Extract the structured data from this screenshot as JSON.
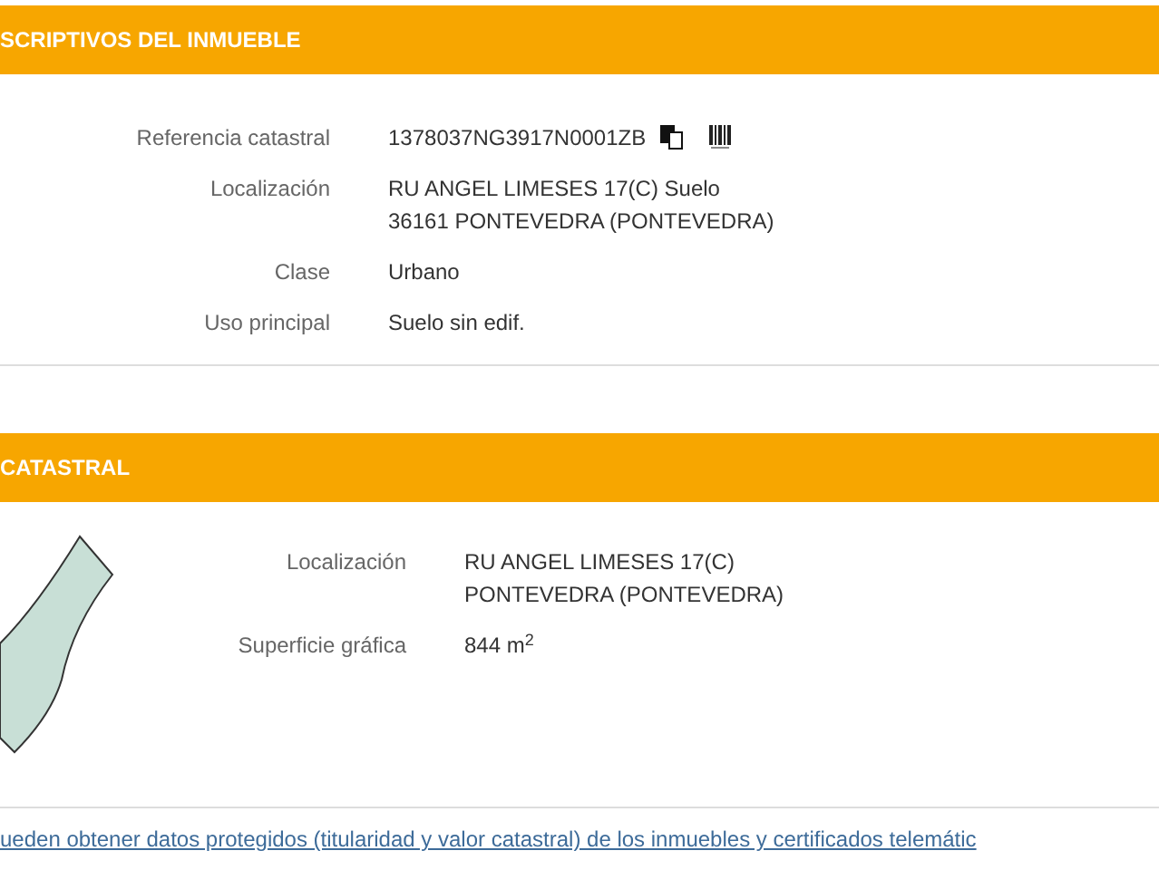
{
  "sections": [
    {
      "title": "SCRIPTIVOS DEL INMUEBLE",
      "kind": "plain",
      "rows": [
        {
          "label": "Referencia catastral",
          "lines": [
            "1378037NG3917N0001ZB"
          ],
          "kind": "reference"
        },
        {
          "label": "Localización",
          "lines": [
            "RU ANGEL LIMESES 17(C) Suelo",
            "36161 PONTEVEDRA (PONTEVEDRA)"
          ],
          "kind": "plain"
        },
        {
          "label": "Clase",
          "lines": [
            "Urbano"
          ],
          "kind": "plain"
        },
        {
          "label": "Uso principal",
          "lines": [
            "Suelo sin edif."
          ],
          "kind": "plain"
        }
      ]
    },
    {
      "title": "CATASTRAL",
      "kind": "parcel",
      "rows": [
        {
          "label": "Localización",
          "lines": [
            "RU ANGEL LIMESES 17(C)",
            "PONTEVEDRA (PONTEVEDRA)"
          ],
          "kind": "plain"
        },
        {
          "label": "Superficie gráfica",
          "lines": [
            "844 m$^{2}$"
          ],
          "kind": "plain"
        }
      ]
    }
  ],
  "footer_link": "ueden obtener datos protegidos (titularidad y valor catastral) de los inmuebles y certificados telemátic"
}
